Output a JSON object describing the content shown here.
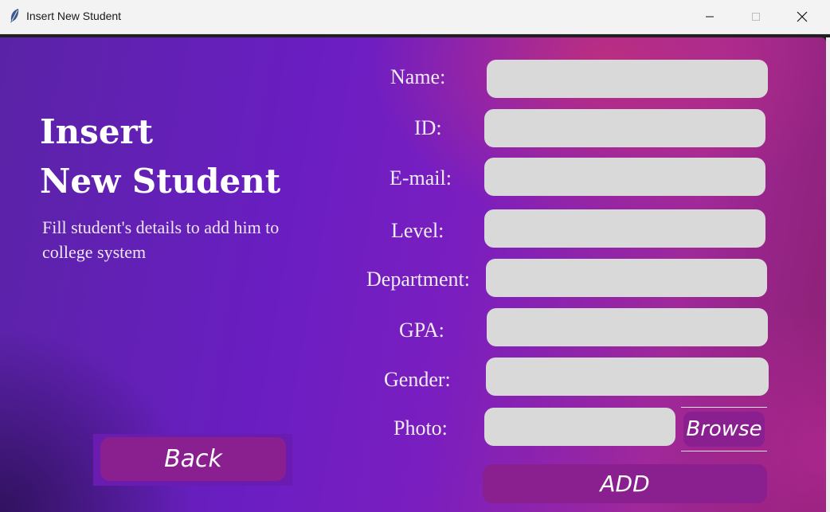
{
  "window": {
    "title": "Insert New Student",
    "icon": "feather-icon"
  },
  "hero": {
    "heading_line1": "Insert",
    "heading_line2": "New Student",
    "subtitle": "Fill student's details to add him to college system"
  },
  "form": {
    "fields": [
      {
        "label": "Name:",
        "value": ""
      },
      {
        "label": "ID:",
        "value": ""
      },
      {
        "label": "E-mail:",
        "value": ""
      },
      {
        "label": "Level:",
        "value": ""
      },
      {
        "label": "Department:",
        "value": ""
      },
      {
        "label": "GPA:",
        "value": ""
      },
      {
        "label": "Gender:",
        "value": ""
      },
      {
        "label": "Photo:",
        "value": ""
      }
    ],
    "browse_label": "Browse",
    "add_label": "ADD"
  },
  "nav": {
    "back_label": "Back"
  },
  "colors": {
    "button_bg": "#8a1f8f",
    "input_bg": "#d9d9d9",
    "gradient_purple": "#6a1ec2",
    "gradient_pink": "#c43078"
  }
}
